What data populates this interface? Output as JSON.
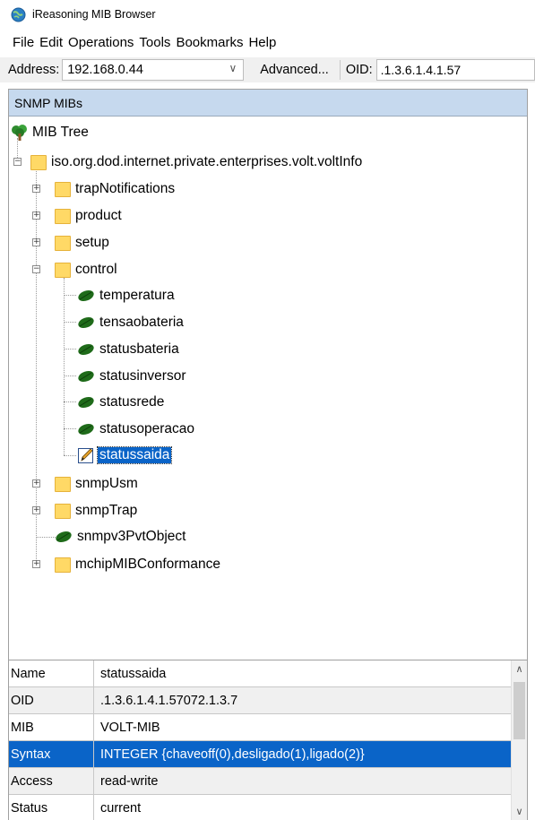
{
  "window": {
    "title": "iReasoning MIB Browser"
  },
  "menu": [
    "File",
    "Edit",
    "Operations",
    "Tools",
    "Bookmarks",
    "Help"
  ],
  "addressbar": {
    "address_label": "Address:",
    "address_value": "192.168.0.44",
    "advanced_label": "Advanced...",
    "oid_label": "OID:",
    "oid_value": ".1.3.6.1.4.1.57"
  },
  "panel": {
    "header": "SNMP MIBs"
  },
  "tree": {
    "root": "MIB Tree",
    "branch": "iso.org.dod.internet.private.enterprises.volt.voltInfo",
    "nodes": [
      "trapNotifications",
      "product",
      "setup",
      "control",
      "temperatura",
      "tensaobateria",
      "statusbateria",
      "statusinversor",
      "statusrede",
      "statusoperacao",
      "statussaida",
      "snmpUsm",
      "snmpTrap",
      "snmpv3PvtObject",
      "mchipMIBConformance"
    ]
  },
  "properties": [
    {
      "key": "Name",
      "value": "statussaida"
    },
    {
      "key": "OID",
      "value": ".1.3.6.1.4.1.57072.1.3.7"
    },
    {
      "key": "MIB",
      "value": "VOLT-MIB"
    },
    {
      "key": "Syntax",
      "value": "INTEGER {chaveoff(0),desligado(1),ligado(2)}"
    },
    {
      "key": "Access",
      "value": "read-write"
    },
    {
      "key": "Status",
      "value": "current"
    }
  ],
  "colors": {
    "selection": "#0a64c8",
    "panel_header": "#c6d9ee",
    "folder": "#ffd966",
    "leaf": "#1f6b1a"
  }
}
